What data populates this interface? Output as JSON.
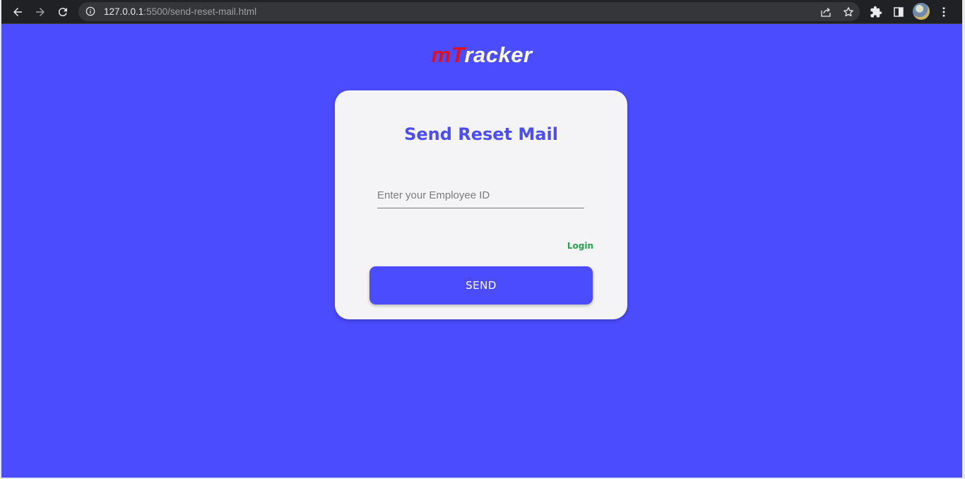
{
  "browser": {
    "url_host": "127.0.0.1",
    "url_rest": ":5500/send-reset-mail.html",
    "icons": [
      "back-arrow-icon",
      "forward-arrow-icon",
      "reload-icon",
      "info-icon",
      "share-icon",
      "star-icon",
      "extensions-icon",
      "side-panel-icon",
      "menu-icon"
    ]
  },
  "logo": {
    "part1": "m",
    "part2": "T",
    "part3": "racker"
  },
  "form": {
    "title": "Send Reset Mail",
    "employee_id_placeholder": "Enter your Employee ID",
    "employee_id_value": "",
    "login_link": "Login",
    "send_button": "SEND"
  },
  "colors": {
    "background": "#4c4cff",
    "card": "#f4f3f5",
    "accent": "#4c4cff",
    "logo_red": "#e0101a",
    "login_green": "#27a14a"
  }
}
